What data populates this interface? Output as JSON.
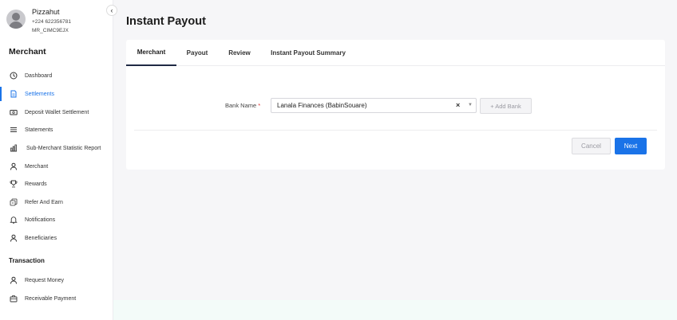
{
  "profile": {
    "name": "Pizzahut",
    "phone": "+224 622356781",
    "merchant_id": "MR_CIMC9EJX"
  },
  "sidebar": {
    "merchant_title": "Merchant",
    "transaction_title": "Transaction",
    "items": [
      {
        "label": "Dashboard",
        "icon": "clock-icon"
      },
      {
        "label": "Settlements",
        "icon": "document-icon",
        "active": true
      },
      {
        "label": "Deposit Wallet Settlement",
        "icon": "wallet-icon"
      },
      {
        "label": "Statements",
        "icon": "list-icon"
      },
      {
        "label": "Sub-Merchant Statistic Report",
        "icon": "bar-chart-icon"
      },
      {
        "label": "Merchant",
        "icon": "user-icon"
      },
      {
        "label": "Rewards",
        "icon": "trophy-icon"
      },
      {
        "label": "Refer And Earn",
        "icon": "money-icon"
      },
      {
        "label": "Notifications",
        "icon": "bell-icon"
      },
      {
        "label": "Beneficiaries",
        "icon": "user-icon"
      }
    ],
    "transaction_items": [
      {
        "label": "Request Money",
        "icon": "user-icon"
      },
      {
        "label": "Receivable Payment",
        "icon": "briefcase-icon"
      }
    ]
  },
  "page": {
    "title": "Instant Payout"
  },
  "tabs": [
    {
      "label": "Merchant",
      "active": true
    },
    {
      "label": "Payout"
    },
    {
      "label": "Review"
    },
    {
      "label": "Instant Payout Summary"
    }
  ],
  "form": {
    "bank_name_label": "Bank Name",
    "required_mark": "*",
    "bank_name_value": "Lanala Finances (BabinSouare)",
    "add_bank_label": "+ Add Bank",
    "cancel_label": "Cancel",
    "next_label": "Next"
  },
  "colors": {
    "accent": "#1a73e8",
    "active_tab_underline": "#1f2a44",
    "required": "#e03131"
  }
}
